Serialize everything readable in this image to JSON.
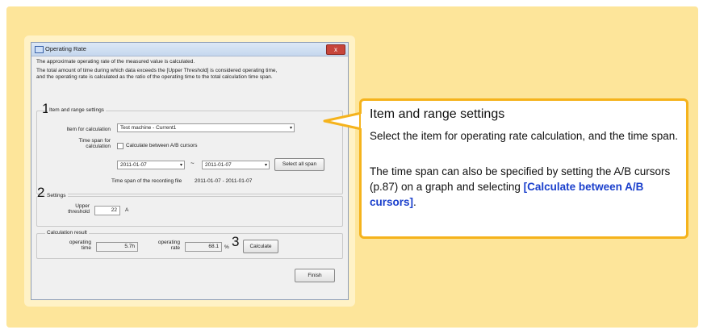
{
  "window": {
    "title": "Operating Rate",
    "close_label": "x",
    "description_1": "The approximate operating rate of the measured value is calculated.",
    "description_2": "The total amount of time during which data exceeds the [Upper Threshold] is considered operating time,",
    "description_3": "and the operating rate is calculated as the ratio of the operating time to the total calculation time span."
  },
  "item_range": {
    "group_label": "Item and range settings",
    "marker": "1",
    "item_label": "Item for calculation",
    "item_value": "Test machine - Current1",
    "timespan_label_1": "Time span for",
    "timespan_label_2": "calculation",
    "checkbox_label": "Calculate between A/B cursors",
    "start_date": "2011-01-07",
    "tilde": "~",
    "end_date": "2011-01-07",
    "select_all_label": "Select all span",
    "recording_label": "Time span of the recording file",
    "recording_value": "2011-01-07 - 2011-01-07"
  },
  "settings": {
    "group_label": "Settings",
    "marker": "2",
    "threshold_label_1": "Upper",
    "threshold_label_2": "threshold",
    "threshold_value": "22",
    "threshold_unit": "A"
  },
  "result": {
    "group_label": "Calculation result",
    "op_time_label_1": "operating",
    "op_time_label_2": "time",
    "op_time_value": "5.7h",
    "op_rate_label_1": "operating",
    "op_rate_label_2": "rate",
    "op_rate_value": "68.1",
    "op_rate_unit": "%",
    "marker": "3",
    "calculate_label": "Calculate"
  },
  "finish_label": "Finish",
  "callout": {
    "title": "Item and range settings",
    "para1": "Select the item for operating rate calculation, and the time span.",
    "para2_a": "The time span can also be specified by setting the A/B cursors (p.87) on a graph and selecting ",
    "para2_link": "[Calculate between A/B cursors]",
    "para2_b": "."
  },
  "colors": {
    "panel": "#fde59a",
    "callout_border": "#f5b31c",
    "link": "#1a3fcc"
  }
}
